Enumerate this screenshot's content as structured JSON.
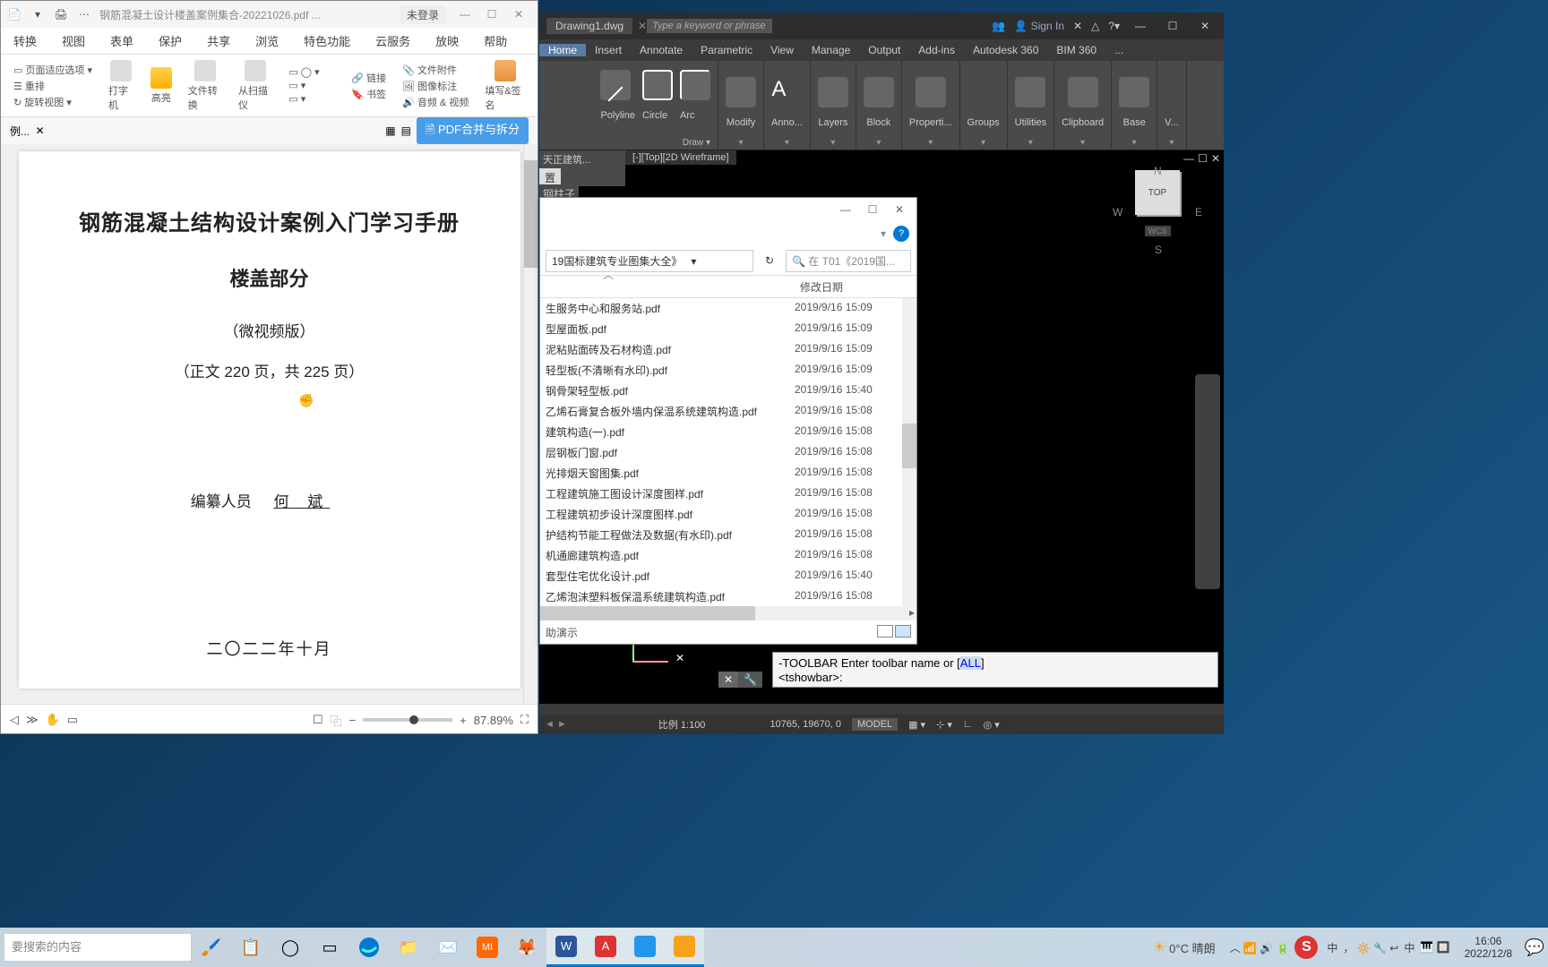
{
  "pdf": {
    "filename": "钢筋混凝土设计楼盖案例集合-20221026.pdf ...",
    "login_badge": "未登录",
    "menu": [
      "转换",
      "视图",
      "表单",
      "保护",
      "共享",
      "浏览",
      "特色功能",
      "云服务",
      "放映",
      "帮助"
    ],
    "toolbar": {
      "page_fit": "页面适应选项",
      "rearrange": "重排",
      "rotate_view": "旋转视图",
      "typewriter": "打字机",
      "highlight": "高亮",
      "file_convert": "文件转换",
      "from_scan": "从扫描仪",
      "link": "链接",
      "bookmark": "书签",
      "file_attach": "文件附件",
      "image_annot": "图像标注",
      "audio_video": "音频 & 视频",
      "fill_sign": "填写&签名"
    },
    "tab_label": "例...",
    "merge_btn": "PDF合并与拆分",
    "doc": {
      "title": "钢筋混凝土结构设计案例入门学习手册",
      "subtitle": "楼盖部分",
      "line1": "（微视频版）",
      "line2": "（正文 220 页，共 225 页）",
      "author_label": "编纂人员",
      "author_name": "何 斌",
      "date": "二〇二二年十月"
    },
    "zoom": "87.89%"
  },
  "acad": {
    "drawing": "Drawing1.dwg",
    "search_placeholder": "Type a keyword or phrase",
    "signin": "Sign In",
    "tabs": [
      "Home",
      "Insert",
      "Annotate",
      "Parametric",
      "View",
      "Manage",
      "Output",
      "Add-ins",
      "Autodesk 360",
      "BIM 360",
      "..."
    ],
    "panels": {
      "polyline": "Polyline",
      "circle": "Circle",
      "arc": "Arc",
      "modify": "Modify",
      "annot": "Anno...",
      "layers": "Layers",
      "block": "Block",
      "props": "Properti...",
      "groups": "Groups",
      "utilities": "Utilities",
      "clipboard": "Clipboard",
      "base": "Base",
      "view": "V...",
      "draw": "Draw"
    },
    "view_tab": "[-][Top][2D Wireframe]",
    "side_label": "天正建筑...",
    "side_sub1": "置",
    "side_sub2": "钢柱子",
    "viewcube": {
      "top": "TOP",
      "n": "N",
      "s": "S",
      "e": "E",
      "w": "W",
      "wcs": "WCS"
    },
    "cmd_line1": "-TOOLBAR Enter toolbar name or [",
    "cmd_all": "ALL",
    "cmd_line2": "<tshowbar>:",
    "coords": "10765, 19670, 0",
    "model": "MODEL",
    "scale": "比例 1:100"
  },
  "explorer": {
    "path": "19国标建筑专业图集大全》",
    "search_ph": "在 T01《2019国...",
    "col_date": "修改日期",
    "files": [
      {
        "name": "生服务中心和服务站.pdf",
        "date": "2019/9/16 15:09"
      },
      {
        "name": "型屋面板.pdf",
        "date": "2019/9/16 15:09"
      },
      {
        "name": "泥粘贴面砖及石材构造.pdf",
        "date": "2019/9/16 15:09"
      },
      {
        "name": "轻型板(不清晰有水印).pdf",
        "date": "2019/9/16 15:09"
      },
      {
        "name": "钢骨架轻型板.pdf",
        "date": "2019/9/16 15:40"
      },
      {
        "name": "乙烯石膏复合板外墙内保温系统建筑构造.pdf",
        "date": "2019/9/16 15:08"
      },
      {
        "name": "建筑构造(一).pdf",
        "date": "2019/9/16 15:08"
      },
      {
        "name": "层钢板门窗.pdf",
        "date": "2019/9/16 15:08"
      },
      {
        "name": "光排烟天窗图集.pdf",
        "date": "2019/9/16 15:08"
      },
      {
        "name": "工程建筑施工图设计深度图样.pdf",
        "date": "2019/9/16 15:08"
      },
      {
        "name": "工程建筑初步设计深度图样.pdf",
        "date": "2019/9/16 15:08"
      },
      {
        "name": "护结构节能工程做法及数据(有水印).pdf",
        "date": "2019/9/16 15:08"
      },
      {
        "name": "机通廊建筑构造.pdf",
        "date": "2019/9/16 15:08"
      },
      {
        "name": "套型住宅优化设计.pdf",
        "date": "2019/9/16 15:40"
      },
      {
        "name": "乙烯泡沫塑料板保温系统建筑构造.pdf",
        "date": "2019/9/16 15:08"
      }
    ],
    "demo": "助演示"
  },
  "taskbar": {
    "search_ph": "要搜索的内容",
    "weather": "0°C 晴朗",
    "ime_main": "中",
    "time": "16:06",
    "date": "2022/12/8"
  }
}
